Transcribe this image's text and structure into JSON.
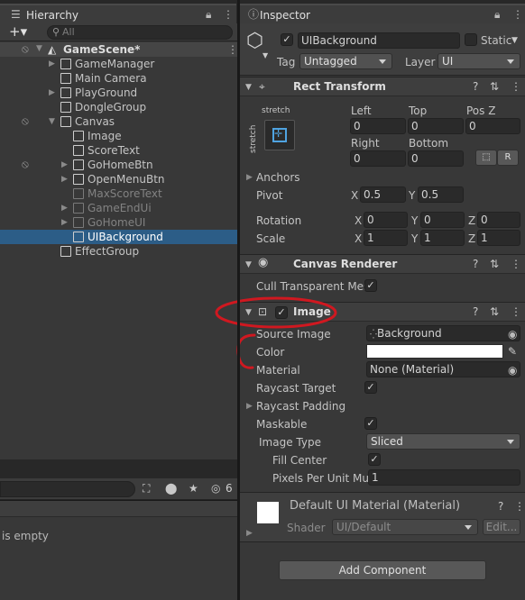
{
  "hierarchy": {
    "tab_label": "Hierarchy",
    "add_label": "+▾",
    "search_placeholder": "All",
    "scene_name": "GameScene*",
    "items": [
      {
        "label": "GameManager"
      },
      {
        "label": "Main Camera"
      },
      {
        "label": "PlayGround"
      },
      {
        "label": "DongleGroup"
      },
      {
        "label": "Canvas"
      },
      {
        "label": "Image"
      },
      {
        "label": "ScoreText"
      },
      {
        "label": "GoHomeBtn"
      },
      {
        "label": "OpenMenuBtn"
      },
      {
        "label": "MaxScoreText"
      },
      {
        "label": "GameEndUi"
      },
      {
        "label": "GoHomeUI"
      },
      {
        "label": "UIBackground"
      },
      {
        "label": "EffectGroup"
      }
    ]
  },
  "bottom_panel": {
    "hidden_count": "6",
    "empty_text": "is empty"
  },
  "inspector": {
    "tab_label": "Inspector",
    "object_name": "UIBackground",
    "static_label": "Static",
    "tag_label": "Tag",
    "tag_value": "Untagged",
    "layer_label": "Layer",
    "layer_value": "UI",
    "rect_transform": {
      "title": "Rect Transform",
      "anchor_h": "stretch",
      "anchor_v": "stretch",
      "left_label": "Left",
      "left_value": "0",
      "top_label": "Top",
      "top_value": "0",
      "posz_label": "Pos Z",
      "posz_value": "0",
      "right_label": "Right",
      "right_value": "0",
      "bottom_label": "Bottom",
      "bottom_value": "0",
      "r_button": "R",
      "anchors_label": "Anchors",
      "pivot_label": "Pivot",
      "pivot_x": "0.5",
      "pivot_y": "0.5",
      "rotation_label": "Rotation",
      "rot_x": "0",
      "rot_y": "0",
      "rot_z": "0",
      "scale_label": "Scale",
      "scale_x": "1",
      "scale_y": "1",
      "scale_z": "1",
      "x": "X",
      "y": "Y",
      "z": "Z"
    },
    "canvas_renderer": {
      "title": "Canvas Renderer",
      "cull_label": "Cull Transparent Mes"
    },
    "image": {
      "title": "Image",
      "source_image_label": "Source Image",
      "source_image_value": "Background",
      "color_label": "Color",
      "color_value": "#ffffff",
      "material_label": "Material",
      "material_value": "None (Material)",
      "raycast_target_label": "Raycast Target",
      "raycast_padding_label": "Raycast Padding",
      "maskable_label": "Maskable",
      "image_type_label": "Image Type",
      "image_type_value": "Sliced",
      "fill_center_label": "Fill Center",
      "ppu_label": "Pixels Per Unit Mul",
      "ppu_value": "1"
    },
    "material_preview": {
      "title": "Default UI Material (Material)",
      "shader_label": "Shader",
      "shader_value": "UI/Default",
      "edit_label": "Edit..."
    },
    "add_component_label": "Add Component"
  },
  "colors": {
    "selection": "#2c5d87",
    "annotation": "#d01820"
  }
}
